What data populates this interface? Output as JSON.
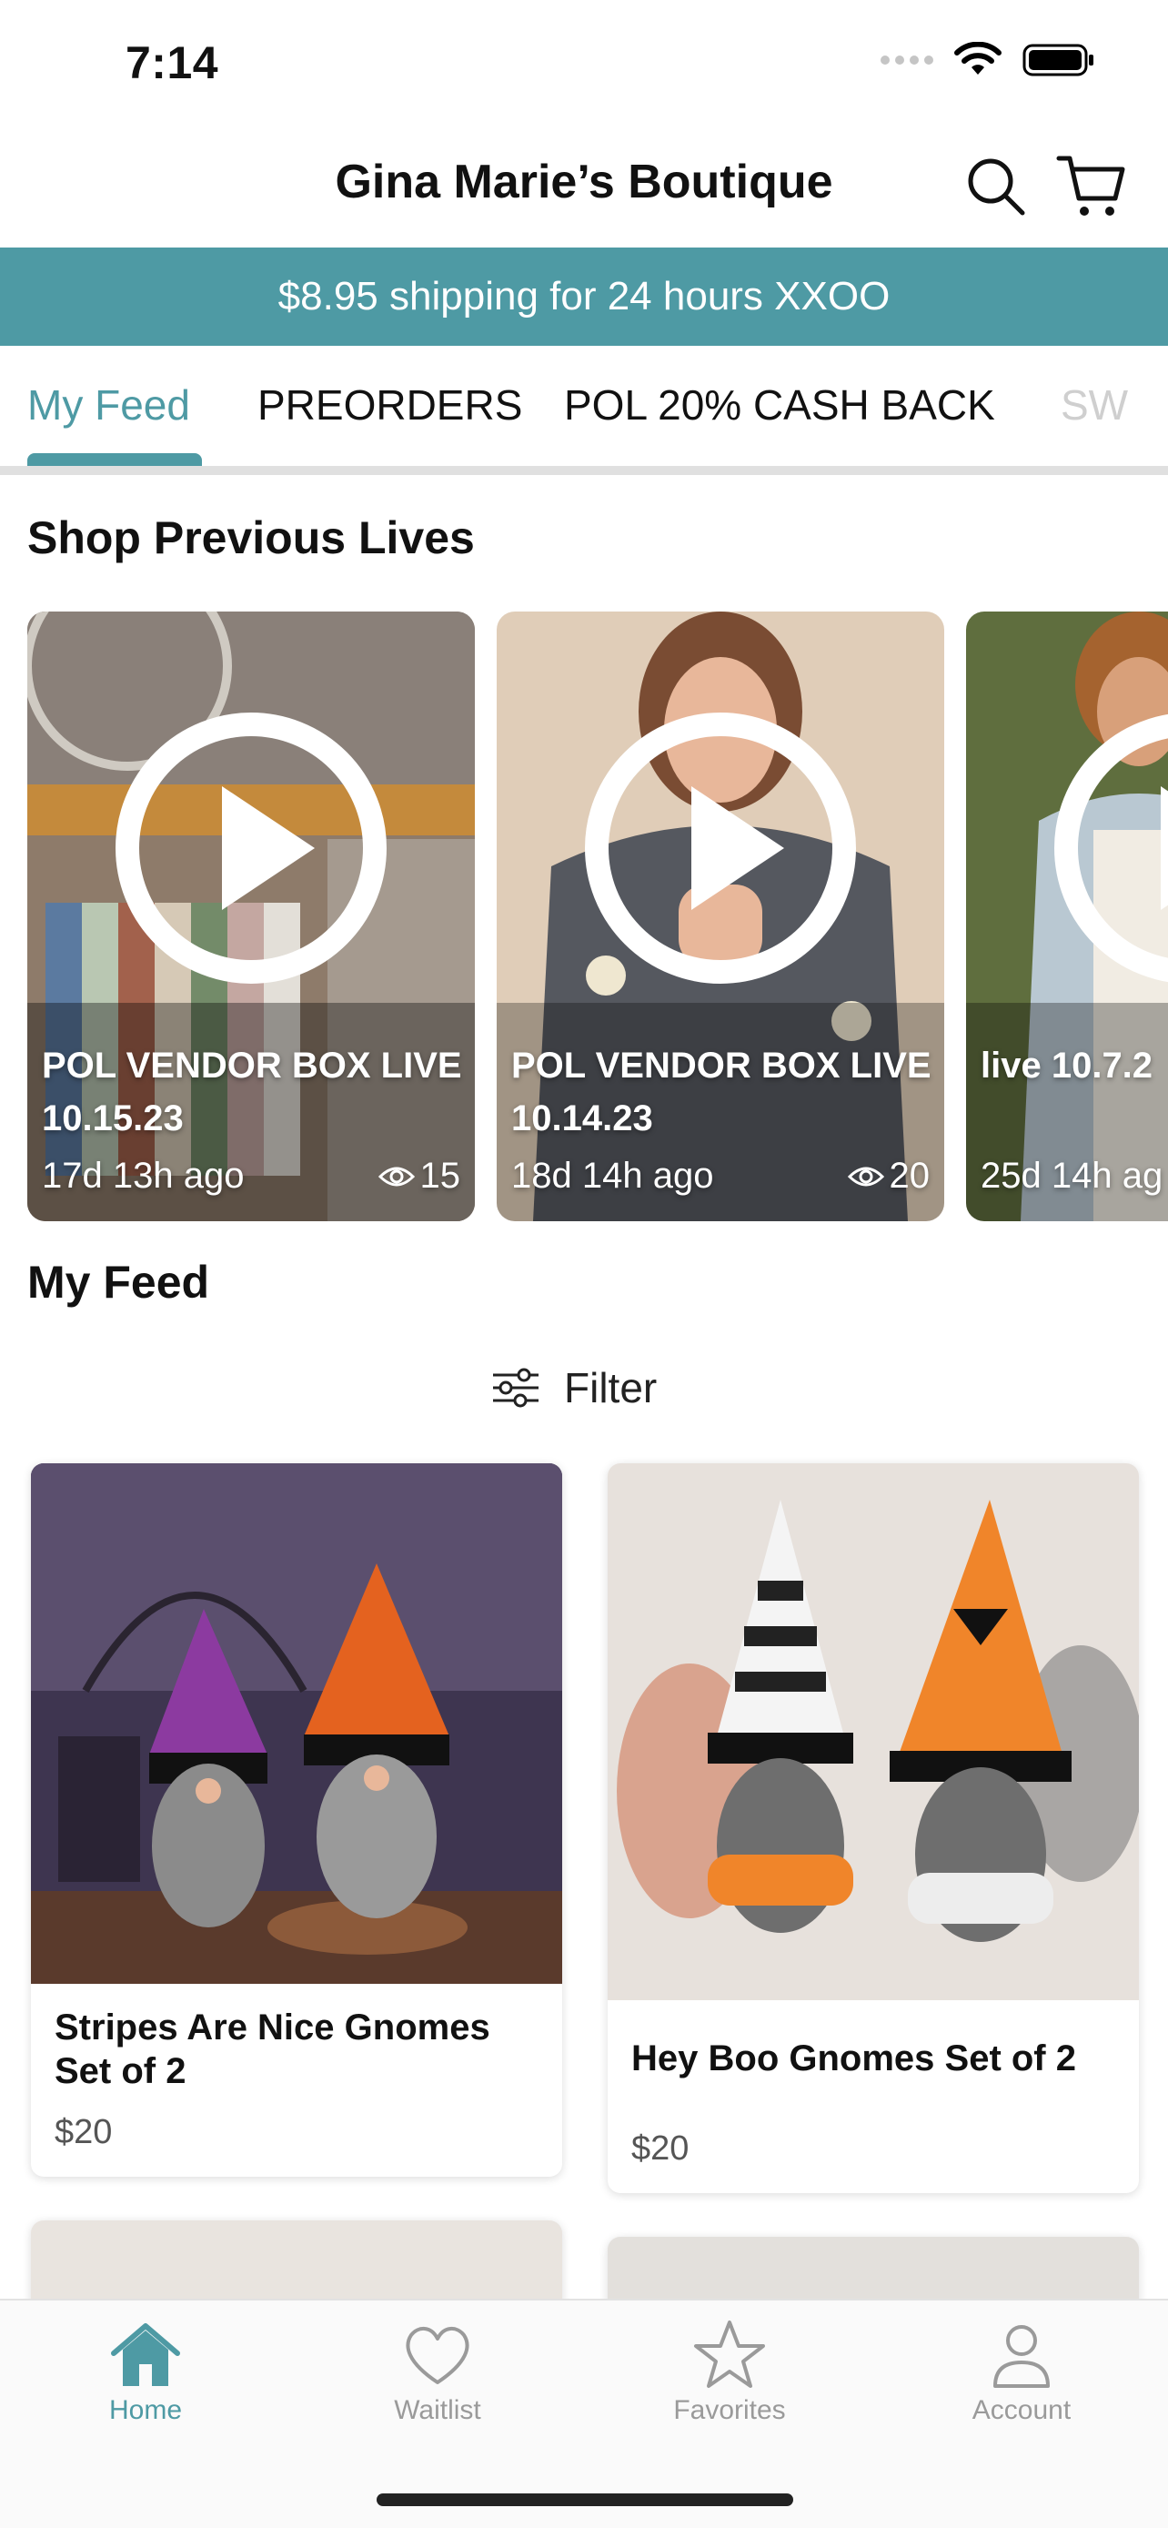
{
  "status_bar": {
    "time": "7:14"
  },
  "header": {
    "title": "Gina Marie’s Boutique"
  },
  "banner": {
    "text": "$8.95 shipping for 24 hours XXOO"
  },
  "tabs": [
    {
      "label": "My Feed"
    },
    {
      "label": "PREORDERS"
    },
    {
      "label": "POL 20% CASH BACK"
    },
    {
      "label": "SW"
    }
  ],
  "previous_lives": {
    "title": "Shop Previous Lives",
    "items": [
      {
        "title": "POL VENDOR BOX LIVE 10.15.23",
        "ago": "17d 13h ago",
        "views": "15"
      },
      {
        "title": "POL VENDOR BOX LIVE 10.14.23",
        "ago": "18d 14h ago",
        "views": "20"
      },
      {
        "title": "live 10.7.2",
        "ago": "25d 14h ag",
        "views": ""
      }
    ]
  },
  "feed": {
    "title": "My Feed",
    "filter_label": "Filter",
    "products": [
      {
        "name": "Stripes Are Nice Gnomes Set of 2",
        "price": "$20"
      },
      {
        "name": "Hey Boo Gnomes Set of 2",
        "price": "$20"
      }
    ]
  },
  "bottom_nav": [
    {
      "label": "Home",
      "icon": "home-icon",
      "active": true
    },
    {
      "label": "Waitlist",
      "icon": "heart-icon",
      "active": false
    },
    {
      "label": "Favorites",
      "icon": "star-icon",
      "active": false
    },
    {
      "label": "Account",
      "icon": "person-icon",
      "active": false
    }
  ],
  "colors": {
    "accent": "#4e9aa4",
    "inactive": "#9a9a9a"
  }
}
